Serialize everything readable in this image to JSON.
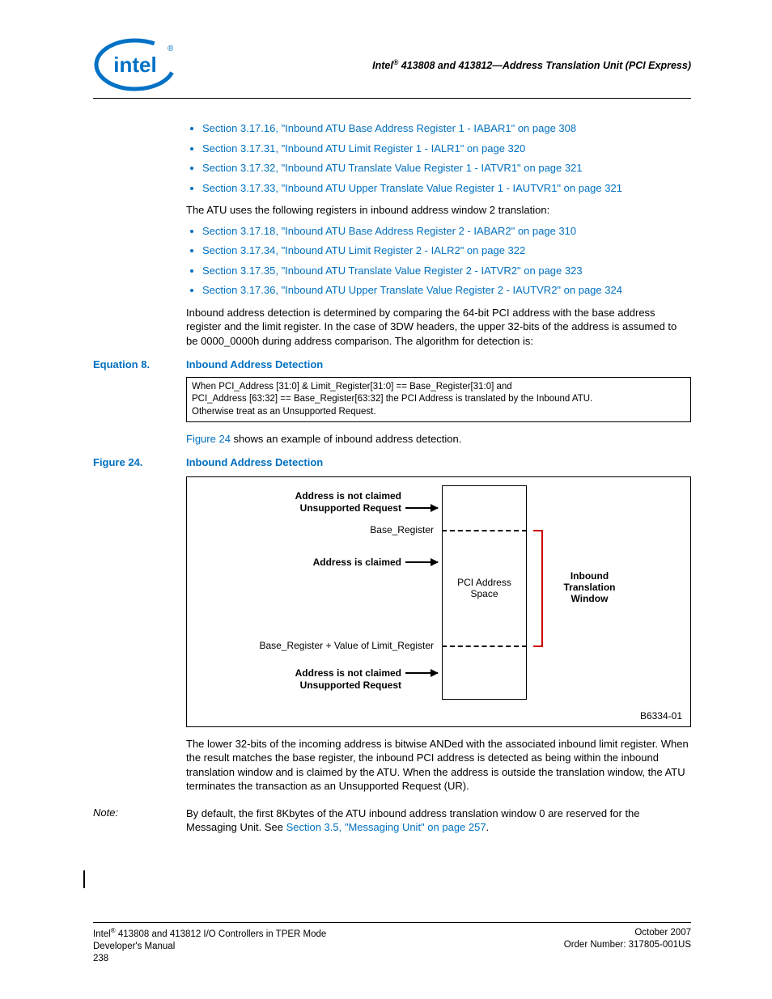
{
  "header": {
    "brand": "intel",
    "title_prefix": "Intel",
    "title_reg": "®",
    "title_rest": " 413808 and 413812—Address Translation Unit (PCI Express)"
  },
  "list1": [
    "Section 3.17.16, \"Inbound ATU Base Address Register 1 - IABAR1\" on page 308",
    "Section 3.17.31, \"Inbound ATU Limit Register 1 - IALR1\" on page 320",
    "Section 3.17.32, \"Inbound ATU Translate Value Register 1 - IATVR1\" on page 321",
    "Section 3.17.33, \"Inbound ATU Upper Translate Value Register 1 - IAUTVR1\" on page 321"
  ],
  "intro2": "The ATU uses the following registers in inbound address window 2 translation:",
  "list2": [
    "Section 3.17.18, \"Inbound ATU Base Address Register 2 - IABAR2\" on page 310",
    "Section 3.17.34, \"Inbound ATU Limit Register 2 - IALR2\" on page 322",
    "Section 3.17.35, \"Inbound ATU Translate Value Register 2 - IATVR2\" on page 323",
    "Section 3.17.36, \"Inbound ATU Upper Translate Value Register 2 - IAUTVR2\" on page 324"
  ],
  "para1": "Inbound address detection is determined by comparing the 64-bit PCI address with the base address register and the limit register. In the case of 3DW headers, the upper 32-bits of the address is assumed to be 0000_0000h during address comparison. The algorithm for detection is:",
  "equation": {
    "label": "Equation 8.",
    "title": "Inbound Address Detection",
    "line1": "When PCI_Address [31:0] & Limit_Register[31:0] == Base_Register[31:0] and",
    "line2": "PCI_Address [63:32] == Base_Register[63:32] the PCI Address is translated by the Inbound ATU.",
    "line3": "Otherwise treat as an Unsupported Request."
  },
  "para2_pre": "Figure 24",
  "para2_post": " shows an example of inbound address detection.",
  "figure": {
    "label": "Figure 24.",
    "title": "Inbound Address Detection",
    "not_claimed": "Address is not claimed",
    "unsupported": "Unsupported Request",
    "base_reg": "Base_Register",
    "claimed": "Address is claimed",
    "pci_space": "PCI Address Space",
    "inbound_window": "Inbound Translation Window",
    "base_plus": "Base_Register + Value of Limit_Register",
    "code": "B6334-01"
  },
  "para3": "The lower 32-bits of the incoming address is bitwise ANDed with the associated inbound limit register. When the result matches the base register, the inbound PCI address is detected as being within the inbound translation window and is claimed by the ATU. When the address is outside the translation window, the ATU terminates the transaction as an Unsupported Request (UR).",
  "note": {
    "label": "Note:",
    "text_pre": "By default, the first 8Kbytes of the ATU inbound address translation window 0 are reserved for the Messaging Unit. See ",
    "link": "Section 3.5, \"Messaging Unit\" on page 257",
    "text_post": "."
  },
  "footer": {
    "left1_a": "Intel",
    "left1_b": " 413808 and 413812 I/O Controllers in TPER Mode",
    "left2": "Developer's Manual",
    "left3": "238",
    "right1": "October 2007",
    "right2": "Order Number: 317805-001US"
  }
}
